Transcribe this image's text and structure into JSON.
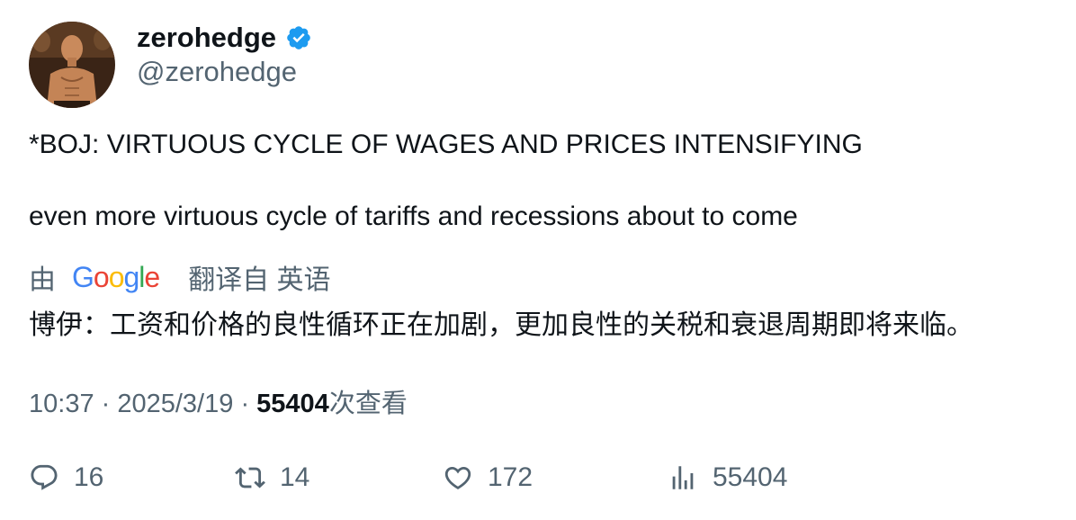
{
  "author": {
    "display_name": "zerohedge",
    "handle": "@zerohedge",
    "verified": true,
    "verified_color": "#1d9bf0",
    "avatar_icon": "avatar-portrait"
  },
  "tweet": {
    "line1": "*BOJ: VIRTUOUS CYCLE OF WAGES AND PRICES INTENSIFYING",
    "line2": "even more virtuous cycle of tariffs and recessions about to come"
  },
  "translation": {
    "prefix": "由",
    "provider": "Google",
    "label": "翻译自 英语",
    "text": "博伊：工资和价格的良性循环正在加剧，更加良性的关税和衰退周期即将来临。"
  },
  "meta": {
    "time": "10:37",
    "separator": "·",
    "date": "2025/3/19",
    "views": "55404",
    "views_suffix": "次查看"
  },
  "actions": {
    "replies": "16",
    "retweets": "14",
    "likes": "172",
    "views": "55404"
  },
  "colors": {
    "text_primary": "#0f1419",
    "text_secondary": "#536471",
    "google_blue": "#4285F4",
    "google_red": "#EA4335",
    "google_yellow": "#FBBC05",
    "google_green": "#34A853"
  }
}
